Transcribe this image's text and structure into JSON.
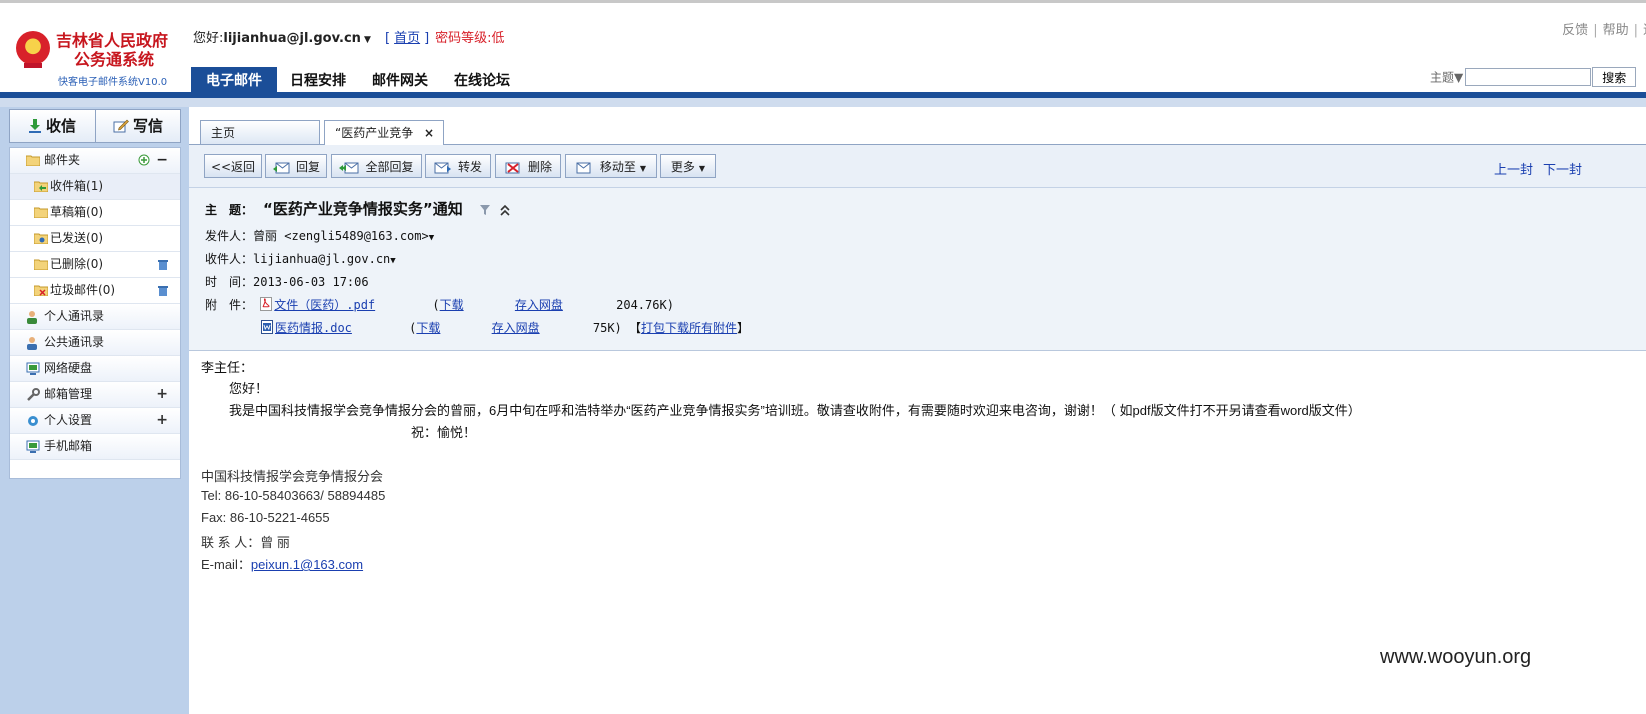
{
  "window": {
    "title": "快客电子邮件系统V10.0"
  },
  "logo": {
    "line1": "吉林省人民政府",
    "line2": "公务通系统",
    "line3": "快客电子邮件系统V10.0"
  },
  "user": {
    "greeting": "您好:",
    "username": "lijianhua@jl.gov.cn",
    "home_link": "首页",
    "bracket_open": "[",
    "bracket_close": "]",
    "password_level": "密码等级:低"
  },
  "toplinks": [
    "反馈",
    "帮助",
    "退"
  ],
  "search": {
    "scope": "主题",
    "placeholder": "",
    "button": "搜索"
  },
  "nav": {
    "tabs": [
      {
        "label": "电子邮件",
        "active": true
      },
      {
        "label": "日程安排"
      },
      {
        "label": "邮件网关"
      },
      {
        "label": "在线论坛"
      }
    ]
  },
  "sidebar": {
    "receive": "收信",
    "write": "写信",
    "folders_label": "邮件夹",
    "folders": [
      {
        "label": "收件箱",
        "count": "(1)"
      },
      {
        "label": "草稿箱",
        "count": "(0)"
      },
      {
        "label": "已发送",
        "count": "(0)"
      },
      {
        "label": "已删除",
        "count": "(0)"
      },
      {
        "label": "垃圾邮件",
        "count": "(0)"
      }
    ],
    "items": [
      {
        "label": "个人通讯录"
      },
      {
        "label": "公共通讯录"
      },
      {
        "label": "网络硬盘"
      },
      {
        "label": "邮箱管理"
      },
      {
        "label": "个人设置"
      },
      {
        "label": "手机邮箱"
      }
    ]
  },
  "tabs": {
    "home": "主页",
    "mail": "“医药产业竞争",
    "close": "×"
  },
  "toolbar": {
    "back": "<<返回",
    "reply": "回复",
    "reply_all": "全部回复",
    "forward": "转发",
    "delete": "删除",
    "move_to": "移动至",
    "more": "更多",
    "prev": "上一封",
    "next": "下一封"
  },
  "mail": {
    "subject_label": "主　题：",
    "subject": "“医药产业竞争情报实务”通知",
    "from_label": "发件人：",
    "from": "曾丽 <zengli5489@163.com>",
    "to_label": "收件人：",
    "to": "lijianhua@jl.gov.cn",
    "time_label": "时　间：",
    "time": "2013-06-03 17:06",
    "attach_label": "附　件：",
    "attachments": [
      {
        "name": "文件（医药）.pdf",
        "download": "下载",
        "open_paren": "(",
        "save": "存入网盘",
        "size": "204.76K)"
      },
      {
        "name": "医药情报.doc",
        "download": "下载",
        "open_paren": "(",
        "save": "存入网盘",
        "size": "75K)"
      }
    ],
    "download_all_open": "【",
    "download_all": "打包下载所有附件",
    "download_all_close": "】",
    "body": {
      "salutation": "李主任：",
      "hello": "您好！",
      "paragraph": "我是中国科技情报学会竞争情报分会的曾丽，6月中旬在呼和浩特举办“医药产业竞争情报实务”培训班。敬请查收附件，有需要随时欢迎来电咨询，谢谢！（ 如pdf版文件打不开另请查看word版文件）",
      "wish": "祝：愉悦！",
      "sig_org": "中国科技情报学会竞争情报分会",
      "sig_tel": "Tel: 86-10-58403663/ 58894485",
      "sig_fax": "Fax: 86-10-5221-4655",
      "sig_contact": "联 系 人：曾 丽",
      "sig_email_label": "E-mail：",
      "sig_email": "peixun.1@163.com"
    }
  },
  "watermark": "www.wooyun.org",
  "colors": {
    "nav_blue": "#1b4e98",
    "logo_red": "#c7161e",
    "link_blue": "#1a3fb0",
    "sidebar_bg": "#bcd0ea"
  }
}
